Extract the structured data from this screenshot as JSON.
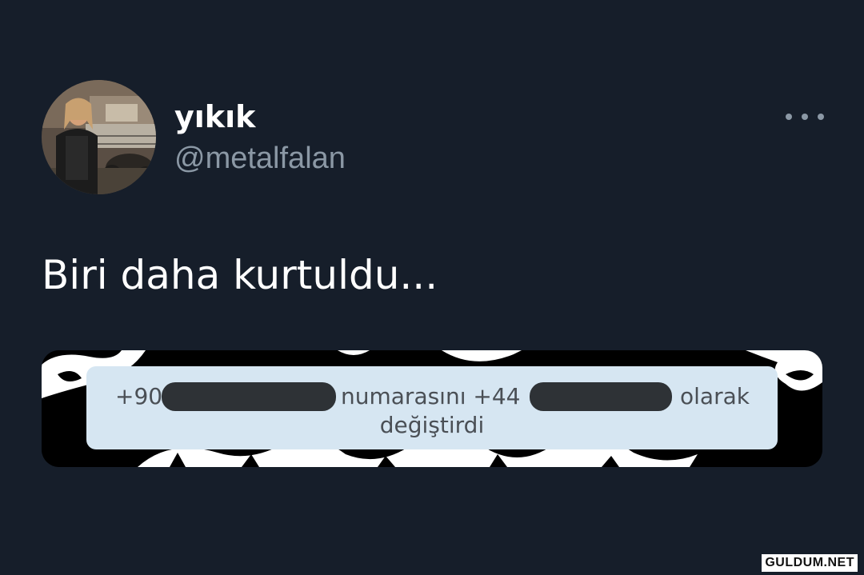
{
  "tweet": {
    "display_name": "yıkık",
    "handle": "@metalfalan",
    "text": "Biri daha kurtuldu...",
    "avatar_icon": "profile-photo",
    "more_icon": "more-horizontal-icon"
  },
  "notice": {
    "part1": "+90",
    "part2": "numarasını +44",
    "part3": "olarak",
    "line2": "değiştirdi"
  },
  "watermark": "GULDUM.NET",
  "colors": {
    "background": "#161e2a",
    "secondary_text": "#8b98a5",
    "notice_bg": "#d6e6f2"
  }
}
